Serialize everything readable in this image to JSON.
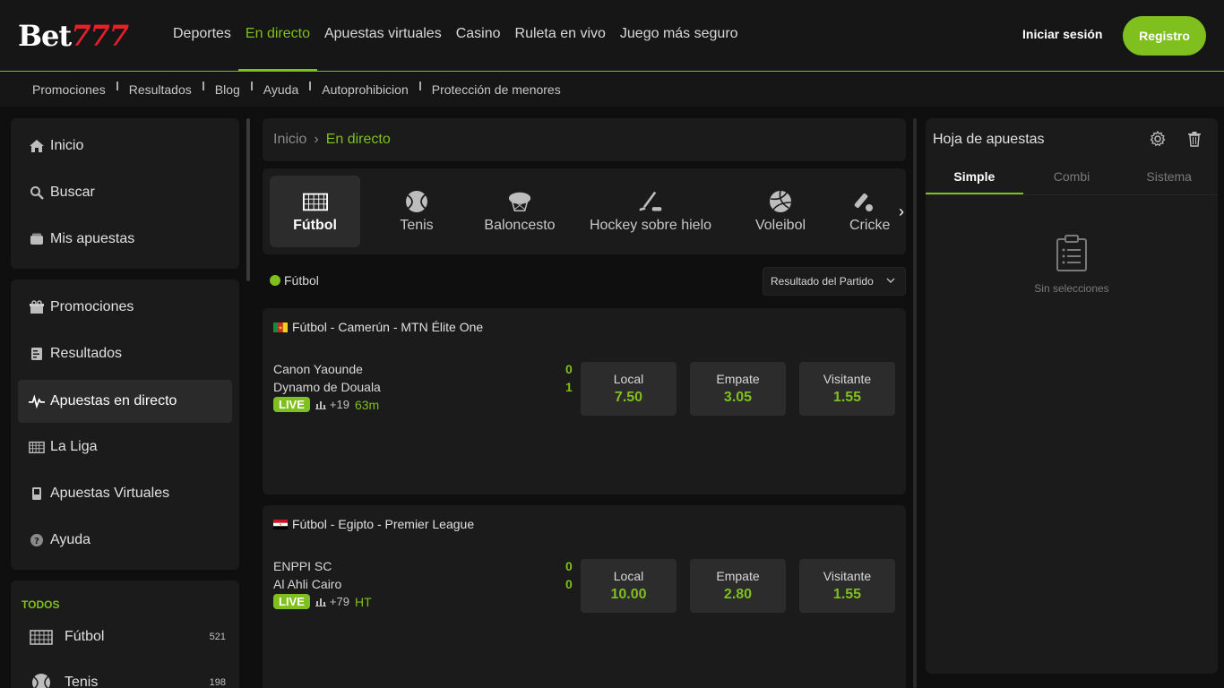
{
  "brand": {
    "logo_white": "Bet",
    "logo_red": "777"
  },
  "nav": {
    "items": [
      {
        "label": "Deportes"
      },
      {
        "label": "En directo"
      },
      {
        "label": "Apuestas virtuales"
      },
      {
        "label": "Casino"
      },
      {
        "label": "Ruleta en vivo"
      },
      {
        "label": "Juego más seguro"
      }
    ],
    "login": "Iniciar sesión",
    "register": "Registro"
  },
  "subnav": [
    "Promociones",
    "Resultados",
    "Blog",
    "Ayuda",
    "Autoprohibicion",
    "Protección de menores"
  ],
  "sidebar": {
    "group1": [
      "Inicio",
      "Buscar",
      "Mis apuestas"
    ],
    "group2": [
      "Promociones",
      "Resultados",
      "Apuestas en directo",
      "La Liga",
      "Apuestas Virtuales",
      "Ayuda"
    ],
    "todos_label": "TODOS",
    "sports": [
      {
        "name": "Fútbol",
        "count": "521"
      },
      {
        "name": "Tenis",
        "count": "198"
      }
    ]
  },
  "breadcrumb": {
    "home": "Inicio",
    "current": "En directo"
  },
  "sport_tabs": [
    "Fútbol",
    "Tenis",
    "Baloncesto",
    "Hockey sobre hielo",
    "Voleibol",
    "Cricke"
  ],
  "filter": {
    "sport": "Fútbol",
    "market": "Resultado del Partido"
  },
  "matches": [
    {
      "league": "Fútbol - Camerún - MTN Élite One",
      "home": "Canon Yaounde",
      "away": "Dynamo de Douala",
      "home_score": "0",
      "away_score": "1",
      "live": "LIVE",
      "more": "+19",
      "time": "63m",
      "odds": [
        {
          "label": "Local",
          "value": "7.50"
        },
        {
          "label": "Empate",
          "value": "3.05"
        },
        {
          "label": "Visitante",
          "value": "1.55"
        }
      ]
    },
    {
      "league": "Fútbol - Egipto - Premier League",
      "home": "ENPPI SC",
      "away": "Al Ahli Cairo",
      "home_score": "0",
      "away_score": "0",
      "live": "LIVE",
      "more": "+79",
      "time": "HT",
      "odds": [
        {
          "label": "Local",
          "value": "10.00"
        },
        {
          "label": "Empate",
          "value": "2.80"
        },
        {
          "label": "Visitante",
          "value": "1.55"
        }
      ]
    }
  ],
  "betslip": {
    "title": "Hoja de apuestas",
    "tabs": [
      "Simple",
      "Combi",
      "Sistema"
    ],
    "empty": "Sin selecciones"
  },
  "colors": {
    "accent": "#7fbf1e",
    "logo_red": "#e8202a",
    "background": "#0f0f0f",
    "panel": "#1b1b1b"
  }
}
